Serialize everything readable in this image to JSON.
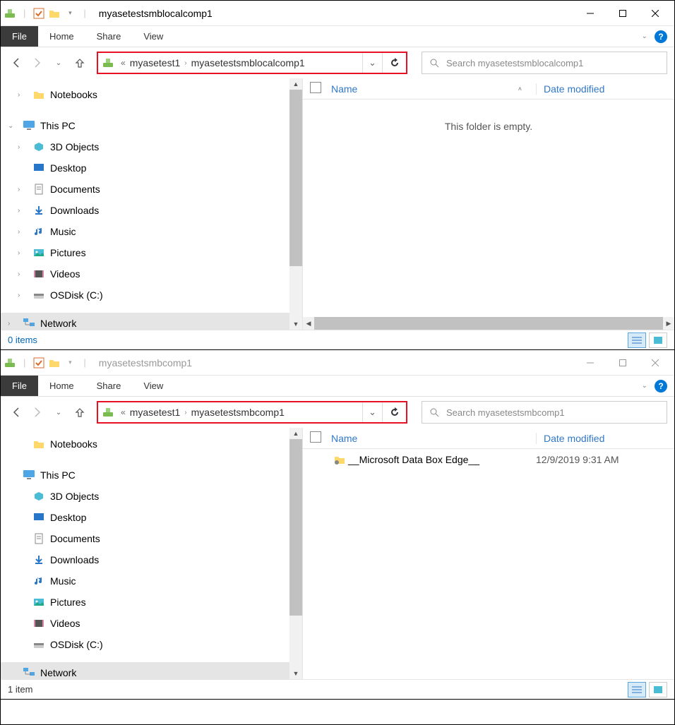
{
  "windows": [
    {
      "title": "myasetestsmblocalcomp1",
      "active": true,
      "ribbon": {
        "file": "File",
        "tabs": [
          "Home",
          "Share",
          "View"
        ]
      },
      "breadcrumb": {
        "parent": "myasetest1",
        "current": "myasetestsmblocalcomp1"
      },
      "search_placeholder": "Search myasetestsmblocalcomp1",
      "tree": {
        "notebooks": "Notebooks",
        "thispc": "This PC",
        "items": [
          "3D Objects",
          "Desktop",
          "Documents",
          "Downloads",
          "Music",
          "Pictures",
          "Videos",
          "OSDisk (C:)"
        ],
        "network": "Network"
      },
      "columns": {
        "name": "Name",
        "date": "Date modified"
      },
      "empty": "This folder is empty.",
      "status": "0 items",
      "rows": []
    },
    {
      "title": "myasetestsmbcomp1",
      "active": false,
      "ribbon": {
        "file": "File",
        "tabs": [
          "Home",
          "Share",
          "View"
        ]
      },
      "breadcrumb": {
        "parent": "myasetest1",
        "current": "myasetestsmbcomp1"
      },
      "search_placeholder": "Search myasetestsmbcomp1",
      "tree": {
        "notebooks": "Notebooks",
        "thispc": "This PC",
        "items": [
          "3D Objects",
          "Desktop",
          "Documents",
          "Downloads",
          "Music",
          "Pictures",
          "Videos",
          "OSDisk (C:)"
        ],
        "network": "Network"
      },
      "columns": {
        "name": "Name",
        "date": "Date modified"
      },
      "empty": "",
      "status": "1 item",
      "rows": [
        {
          "name": "__Microsoft Data Box Edge__",
          "date": "12/9/2019 9:31 AM"
        }
      ]
    }
  ]
}
